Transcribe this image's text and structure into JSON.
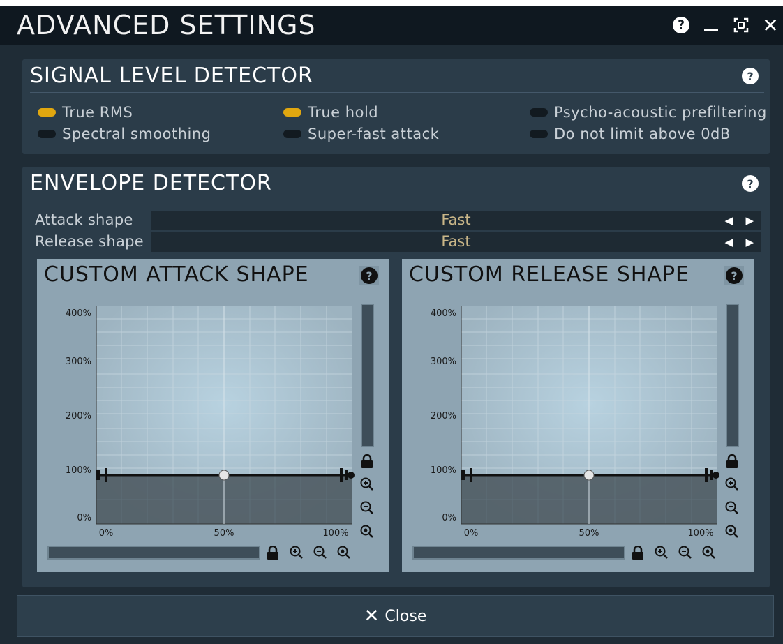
{
  "window": {
    "title": "ADVANCED SETTINGS",
    "help_glyph": "?",
    "close_glyph": "✕"
  },
  "signal_level_detector": {
    "title": "SIGNAL LEVEL DETECTOR",
    "help_glyph": "?",
    "toggles": [
      {
        "label": "True RMS",
        "on": true
      },
      {
        "label": "True hold",
        "on": true
      },
      {
        "label": "Psycho-acoustic prefiltering",
        "on": false
      },
      {
        "label": "Spectral smoothing",
        "on": false
      },
      {
        "label": "Super-fast attack",
        "on": false
      },
      {
        "label": "Do not limit above 0dB",
        "on": false
      }
    ]
  },
  "envelope_detector": {
    "title": "ENVELOPE DETECTOR",
    "help_glyph": "?",
    "attack_shape": {
      "label": "Attack shape",
      "value": "Fast"
    },
    "release_shape": {
      "label": "Release shape",
      "value": "Fast"
    },
    "arrow_left": "◀",
    "arrow_right": "▶"
  },
  "custom_attack_shape": {
    "title": "CUSTOM ATTACK SHAPE",
    "help_glyph": "?",
    "y_ticks": [
      "400%",
      "300%",
      "200%",
      "100%",
      "0%"
    ],
    "x_ticks": [
      "0%",
      "50%",
      "100%"
    ],
    "curve_level_percent": 100,
    "midpoint_percent": 50
  },
  "custom_release_shape": {
    "title": "CUSTOM RELEASE SHAPE",
    "help_glyph": "?",
    "y_ticks": [
      "400%",
      "300%",
      "200%",
      "100%",
      "0%"
    ],
    "x_ticks": [
      "0%",
      "50%",
      "100%"
    ],
    "curve_level_percent": 100,
    "midpoint_percent": 50
  },
  "footer": {
    "close_label": "Close",
    "close_glyph": "✕"
  },
  "colors": {
    "toggle_on": "#e1a70f",
    "toggle_off": "#121a20",
    "value_text": "#c9b688",
    "panel_bg": "#8ea4b2"
  }
}
